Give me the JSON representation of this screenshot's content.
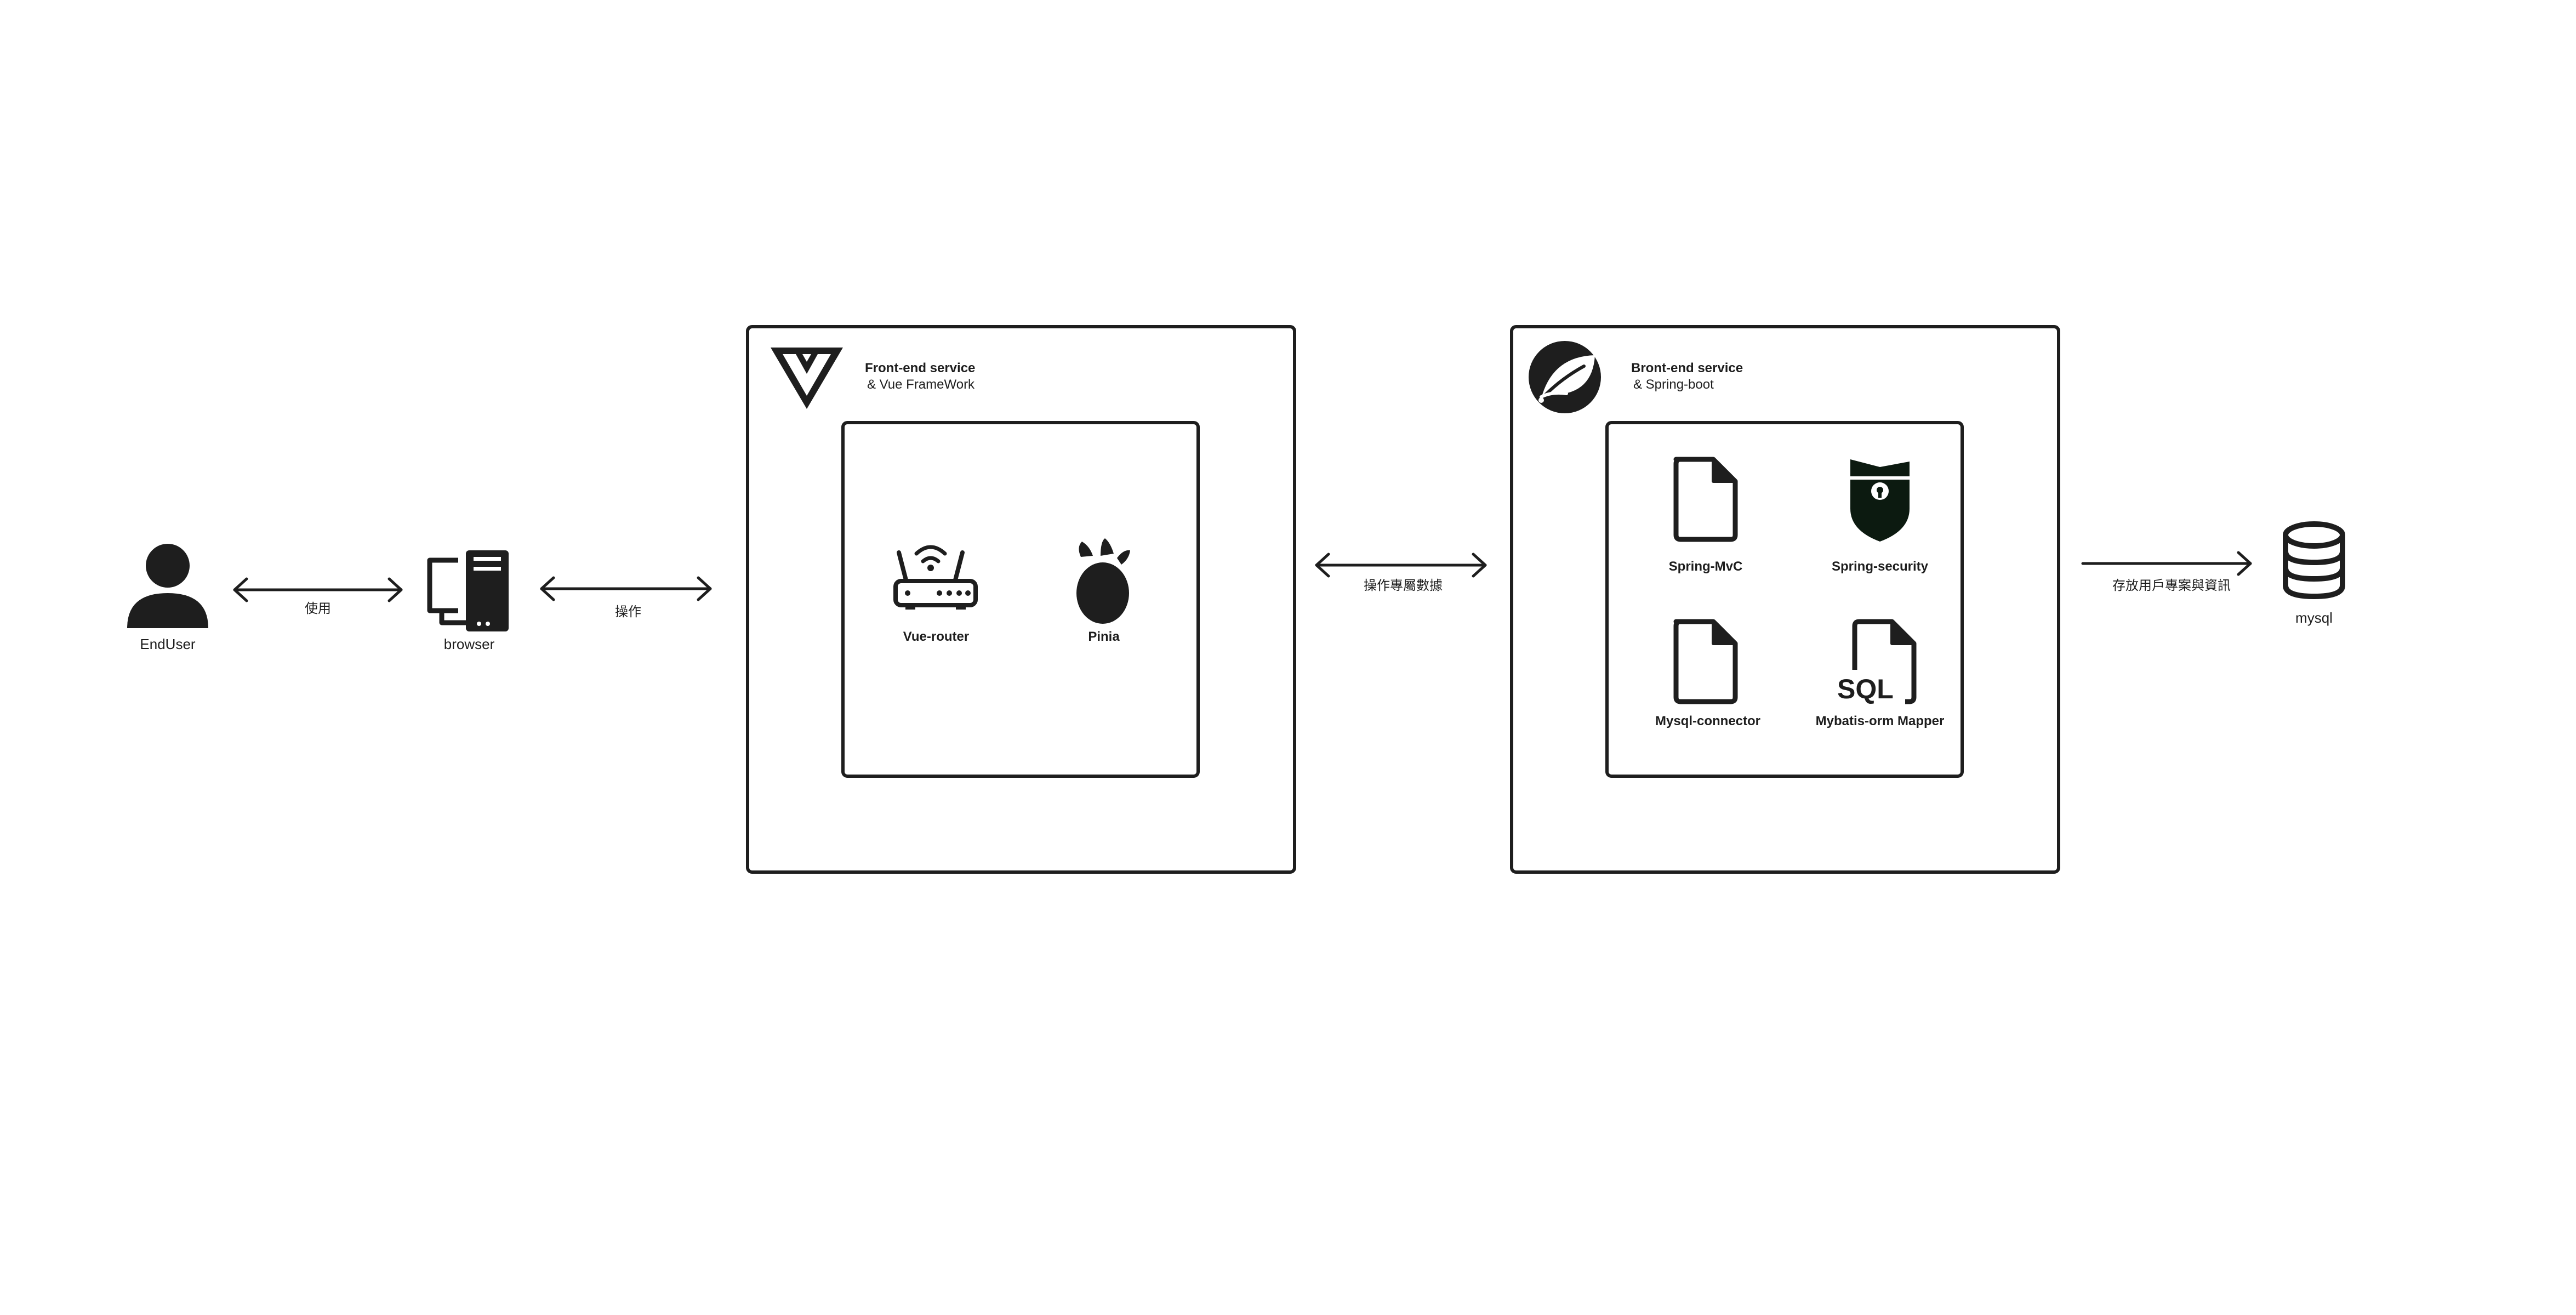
{
  "nodes": {
    "end_user": "EndUser",
    "browser": "browser",
    "mysql": "mysql"
  },
  "edges": {
    "user_browser": "使用",
    "browser_frontend": "操作",
    "frontend_backend": "操作專屬數據",
    "backend_mysql": "存放用戶專案與資訊"
  },
  "frontend": {
    "title": "Front-end service",
    "subtitle": "& Vue FrameWork",
    "components": [
      "Vue-router",
      "Pinia"
    ]
  },
  "backend": {
    "title": "Bront-end service",
    "subtitle": "& Spring-boot",
    "components": [
      "Spring-MvC",
      "Spring-security",
      "Mysql-connector",
      "Mybatis-orm Mapper"
    ],
    "sql_glyph": "SQL"
  },
  "colors": {
    "stroke": "#1e1e1e",
    "icon_fill": "#1e1e1e",
    "shield_fill": "#0c1a10",
    "background": "#ffffff"
  }
}
